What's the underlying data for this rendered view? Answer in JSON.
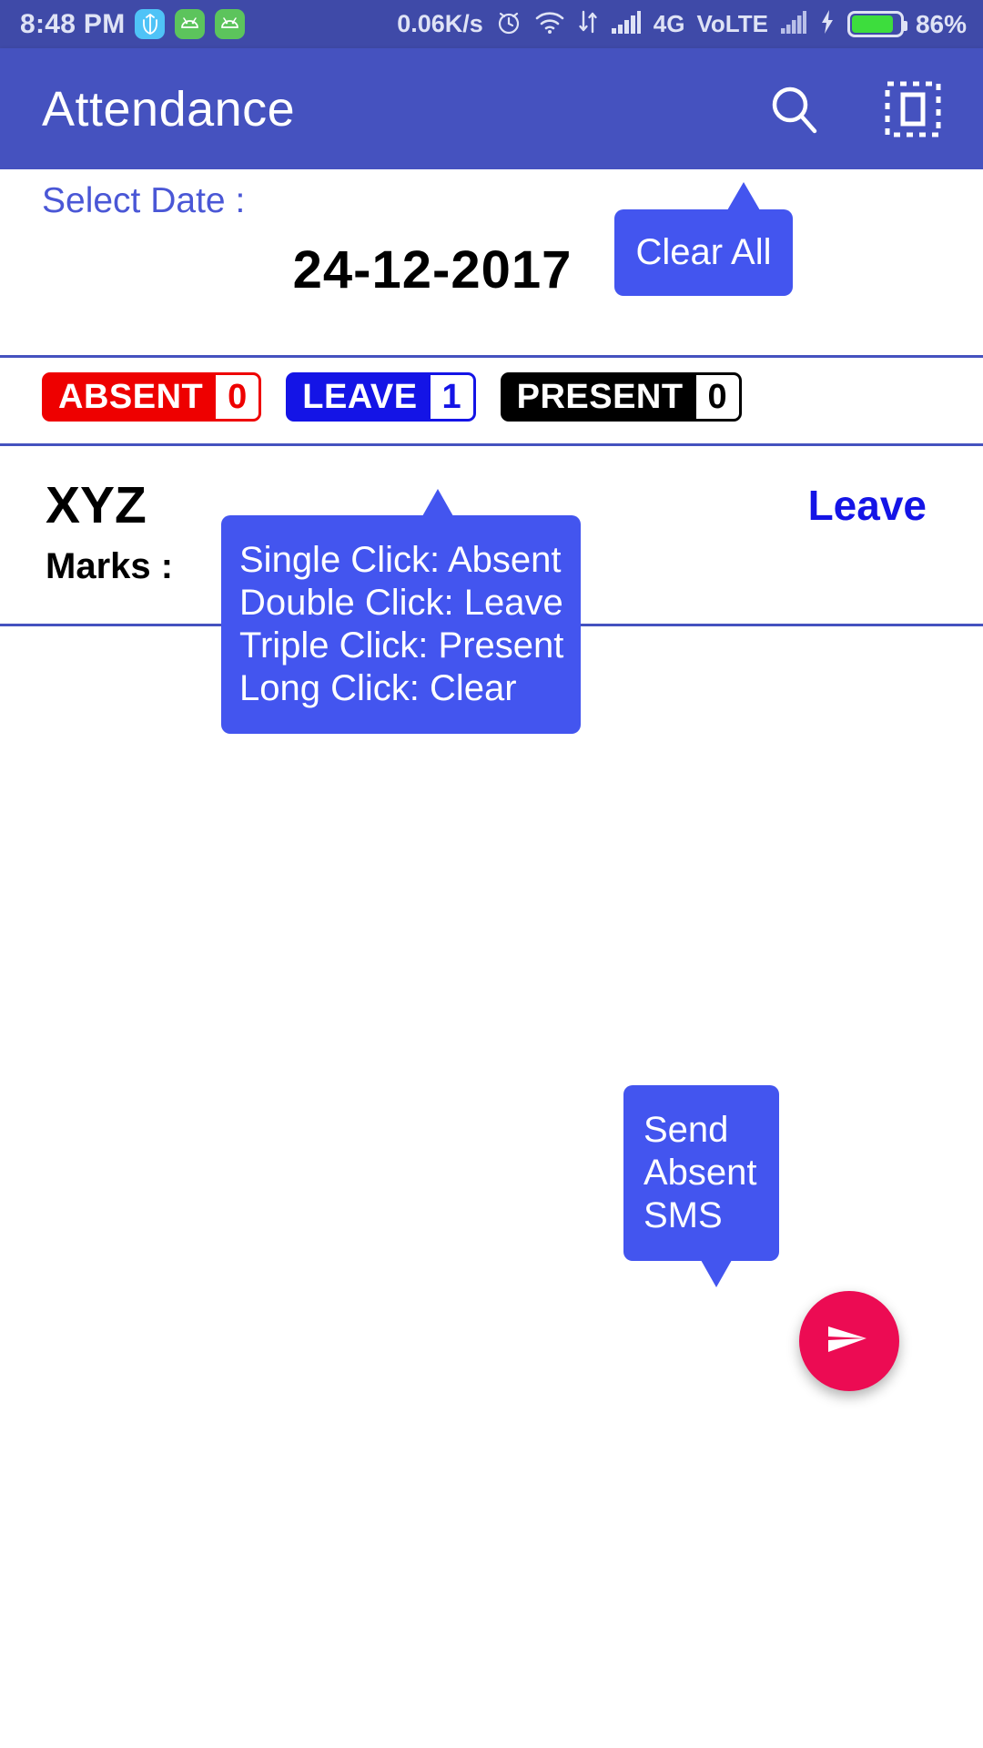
{
  "statusbar": {
    "time": "8:48 PM",
    "icons": [
      "usb-trident-icon",
      "android-app-icon",
      "android-app-icon"
    ],
    "network_speed": "0.06K/s",
    "alarm": "alarm-icon",
    "wifi": "wifi-icon",
    "data_transfer": "data-transfer-icon",
    "signal1": "signal-bars-icon",
    "network_type": "4G",
    "volte": "VoLTE",
    "signal2": "signal-bars-icon",
    "charging": "charging-bolt-icon",
    "battery_percent": "86%",
    "battery_level": 86
  },
  "appbar": {
    "title": "Attendance",
    "search_icon": "search-icon",
    "select_icon": "select-all-dashed-icon",
    "bg": "#4552bf"
  },
  "date_section": {
    "label": "Select Date :",
    "value": "24-12-2017"
  },
  "badges": [
    {
      "label": "ABSENT",
      "count": "0",
      "color": "#ee0000",
      "name": "absent"
    },
    {
      "label": "LEAVE",
      "count": "1",
      "color": "#1414e6",
      "name": "leave"
    },
    {
      "label": "PRESENT",
      "count": "0",
      "color": "#000000",
      "name": "present"
    }
  ],
  "student": {
    "name": "XYZ",
    "marks_label": "Marks :",
    "status": "Leave",
    "status_color": "#1414e6"
  },
  "tooltips": {
    "clear_all": "Clear All",
    "click_help": [
      "Single Click: Absent",
      "Double Click: Leave",
      "Triple Click: Present",
      "Long Click: Clear"
    ],
    "send_sms": [
      "Send",
      "Absent",
      "SMS"
    ],
    "bg": "#4355ef"
  },
  "fab": {
    "icon": "send-icon",
    "color": "#ec0b53"
  }
}
